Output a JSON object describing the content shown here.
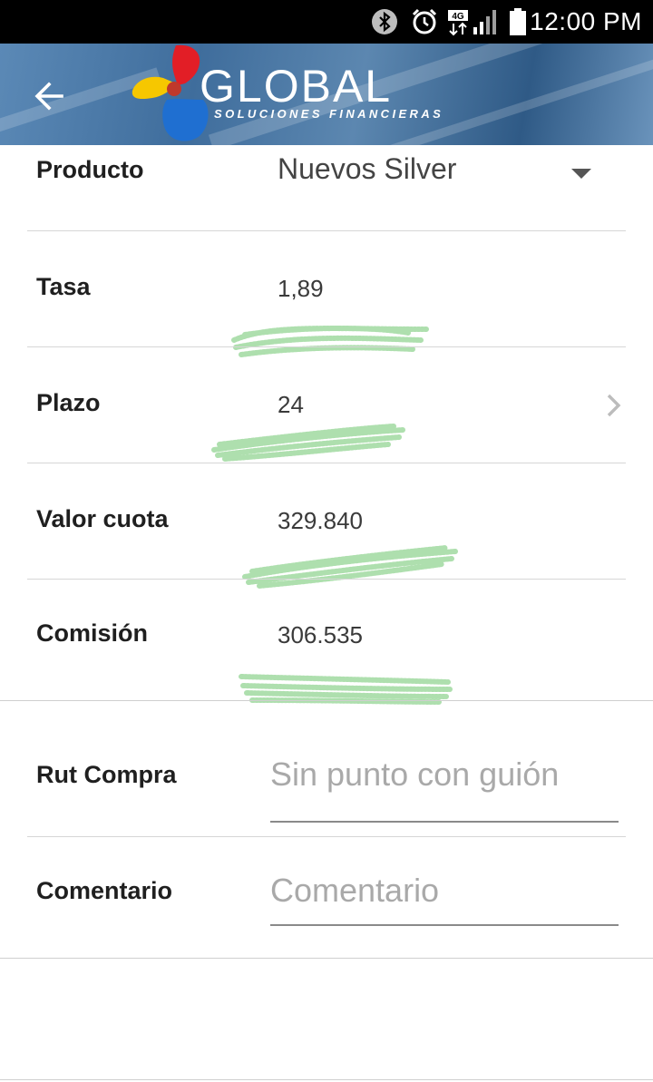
{
  "status_bar": {
    "time": "12:00 PM",
    "network": "4G",
    "icons": [
      "bluetooth-icon",
      "alarm-icon",
      "network-4g-icon",
      "signal-icon",
      "battery-icon"
    ]
  },
  "header": {
    "back_icon": "arrow-left-icon",
    "brand": "GLOBAL",
    "tagline": "SOLUCIONES FINANCIERAS",
    "logo_colors": {
      "red": "#e21e26",
      "yellow": "#f6c700",
      "blue": "#1f6fd1"
    }
  },
  "form": {
    "producto": {
      "label": "Producto",
      "value": "Nuevos Silver"
    },
    "tasa": {
      "label": "Tasa",
      "value": "1,89"
    },
    "plazo": {
      "label": "Plazo",
      "value": "24"
    },
    "valor_cuota": {
      "label": "Valor cuota",
      "value": "329.840"
    },
    "comision": {
      "label": "Comisión",
      "value": "306.535"
    },
    "rut_compra": {
      "label": "Rut Compra",
      "placeholder": "Sin punto con guión",
      "value": ""
    },
    "comentario": {
      "label": "Comentario",
      "placeholder": "Comentario",
      "value": ""
    }
  },
  "colors": {
    "accent_scribble": "#6cc46c",
    "divider": "#d6d6d6"
  }
}
